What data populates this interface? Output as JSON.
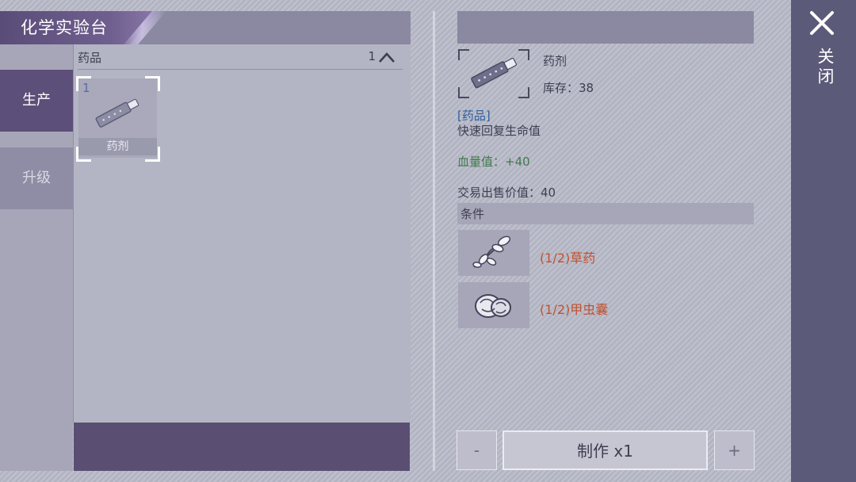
{
  "title": "化学实验台",
  "side_tabs": [
    {
      "label": "生产",
      "active": true
    },
    {
      "label": "升级",
      "active": false
    }
  ],
  "category": {
    "label": "药品",
    "count": "1",
    "icon": "chevron-up-icon"
  },
  "items": [
    {
      "count": "1",
      "label": "药剂",
      "icon": "medicine-syringe-icon",
      "selected": true
    }
  ],
  "detail": {
    "name": "药剂",
    "stock": "库存：38",
    "category": "[药品]",
    "description": "快速回复生命值",
    "hp": "血量值：+40",
    "sell_price": "交易出售价值：40",
    "conditions_label": "条件",
    "conditions": [
      {
        "text": "(1/2)草药",
        "icon": "herb-icon"
      },
      {
        "text": "(1/2)甲虫囊",
        "icon": "beetle-sac-icon"
      }
    ]
  },
  "buttons": {
    "minus": "-",
    "make": "制作 x1",
    "plus": "+"
  },
  "close": {
    "label": "关闭",
    "icon": "close-icon"
  },
  "colors": {
    "accent": "#5c4f79",
    "warning_text": "#c0522f",
    "positive_text": "#3f7a4a",
    "category_text": "#2d5fa0"
  }
}
